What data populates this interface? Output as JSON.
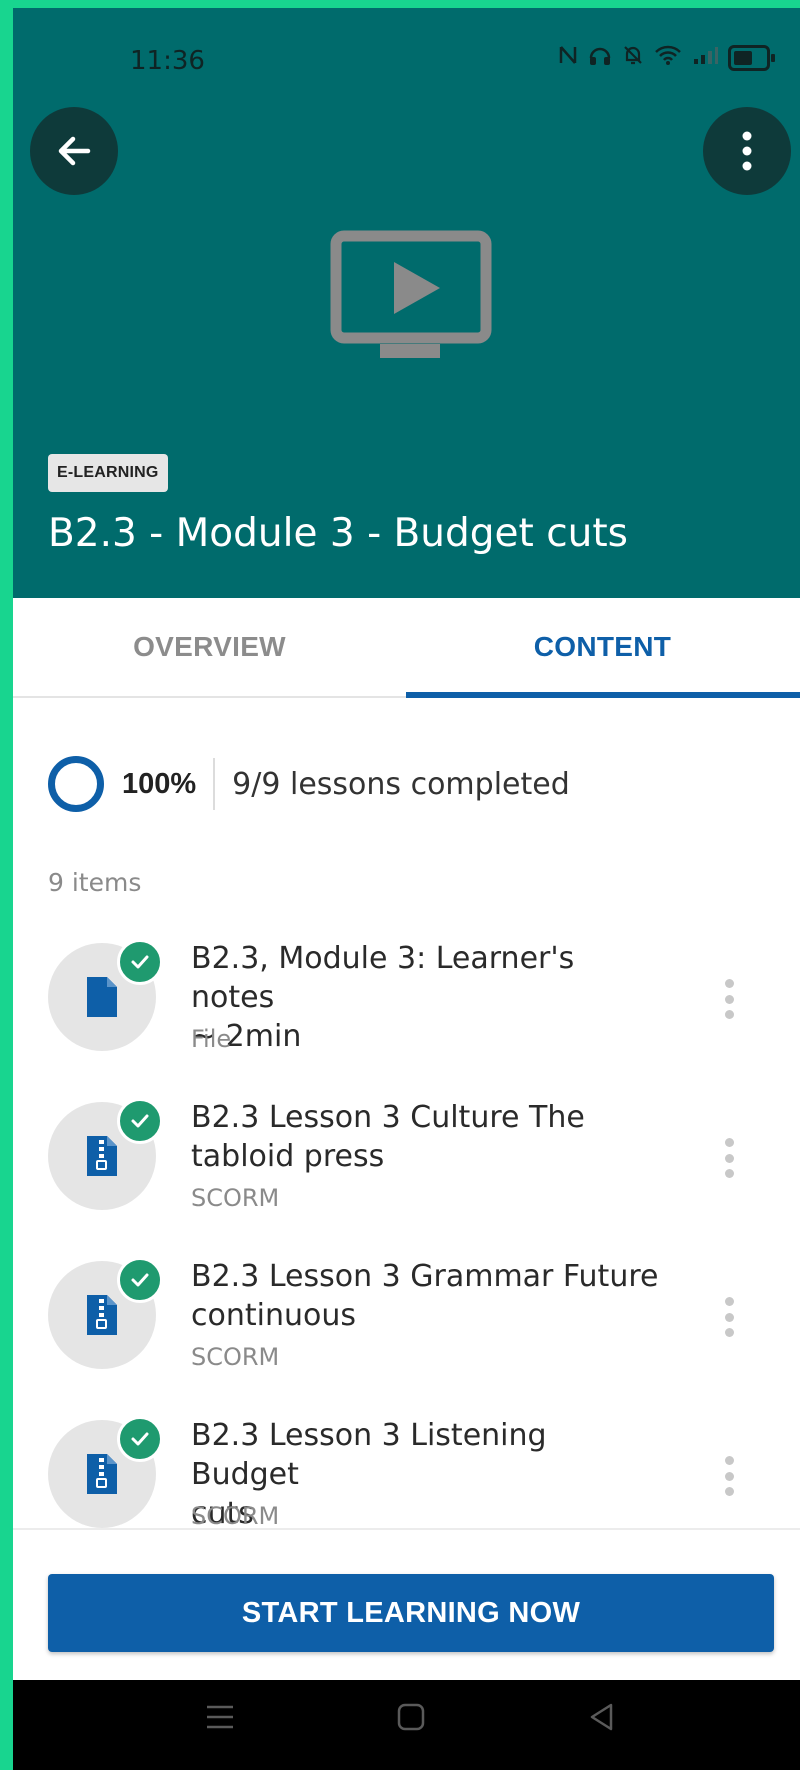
{
  "status_bar": {
    "time": "11:36"
  },
  "header": {
    "badge": "E-LEARNING",
    "title": "B2.3 - Module 3 - Budget cuts"
  },
  "tabs": [
    {
      "label": "OVERVIEW",
      "active": false
    },
    {
      "label": "CONTENT",
      "active": true
    }
  ],
  "progress": {
    "percent_label": "100%",
    "summary": "9/9 lessons completed",
    "value": 1.0
  },
  "list": {
    "count_label": "9 items",
    "items": [
      {
        "title_line1": "B2.3, Module 3: Learner's notes",
        "title_line2": "~ 2min",
        "type": "File",
        "icon": "file-icon",
        "completed": true
      },
      {
        "title_line1": "B2.3 Lesson 3 Culture The",
        "title_line2": "tabloid press",
        "type": "SCORM",
        "icon": "zip-file-icon",
        "completed": true
      },
      {
        "title_line1": "B2.3 Lesson 3 Grammar Future",
        "title_line2": "continuous",
        "type": "SCORM",
        "icon": "zip-file-icon",
        "completed": true
      },
      {
        "title_line1": "B2.3 Lesson 3 Listening Budget",
        "title_line2": "cuts",
        "type": "SCORM",
        "icon": "zip-file-icon",
        "completed": true
      }
    ]
  },
  "cta": {
    "label": "START LEARNING NOW"
  },
  "colors": {
    "header": "#006b6c",
    "accent": "#0e5fa8",
    "check": "#1f9a6f",
    "frame": "#18d58f"
  }
}
